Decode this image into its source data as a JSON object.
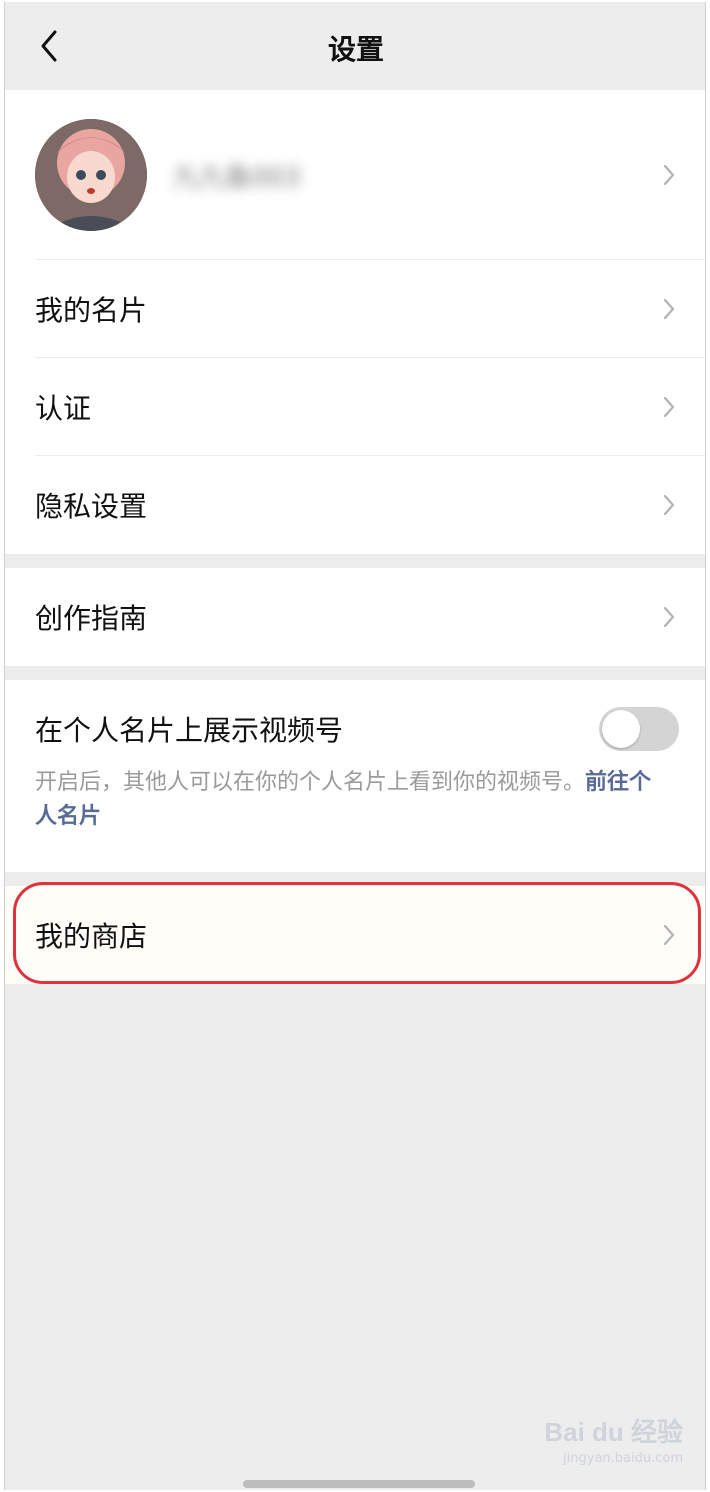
{
  "header": {
    "title": "设置"
  },
  "profile": {
    "nickname": "九九鱼003"
  },
  "menu_group_1": [
    {
      "label": "我的名片"
    },
    {
      "label": "认证"
    },
    {
      "label": "隐私设置"
    }
  ],
  "menu_group_2": [
    {
      "label": "创作指南"
    }
  ],
  "channel_toggle": {
    "title": "在个人名片上展示视频号",
    "enabled": false,
    "description": "开启后，其他人可以在你的个人名片上看到你的视频号。",
    "link_text": "前往个人名片"
  },
  "store": {
    "label": "我的商店"
  },
  "watermark": {
    "main": "Bai du 经验",
    "sub": "jingyan.baidu.com"
  },
  "colors": {
    "background": "#ededed",
    "link": "#576b95",
    "highlight": "#e0323c",
    "toggle_off": "#d4d4d4"
  }
}
